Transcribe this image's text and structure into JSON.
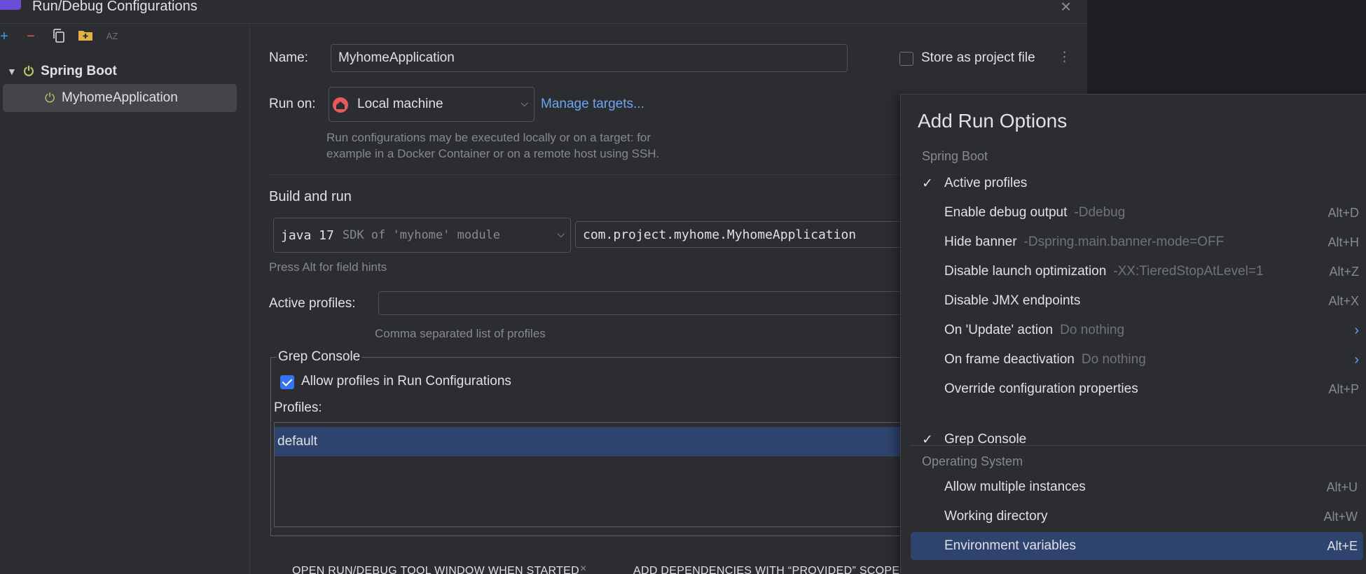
{
  "window": {
    "title": "Run/Debug Configurations",
    "close_glyph": "×"
  },
  "toolbar": {
    "add_glyph": "+",
    "remove_glyph": "−",
    "sort_glyph": "AZ"
  },
  "tree": {
    "group_label": "Spring Boot",
    "item_label": "MyhomeApplication"
  },
  "form": {
    "name_label": "Name:",
    "name_value": "MyhomeApplication",
    "store_label": "Store as project file",
    "run_on_label": "Run on:",
    "run_on_value": "Local machine",
    "manage_targets": "Manage targets...",
    "run_on_hint_1": "Run configurations may be executed locally or on a target: for",
    "run_on_hint_2": "example in a Docker Container or on a remote host using SSH.",
    "build_title": "Build and run",
    "jdk_value": "java 17",
    "jdk_hint": "SDK of 'myhome' module",
    "main_class": "com.project.myhome.MyhomeApplication",
    "field_hint": "Press Alt for field hints",
    "profiles_label": "Active profiles:",
    "profiles_hint": "Comma separated list of profiles",
    "grep_title": "Grep Console",
    "allow_profiles_label": "Allow profiles in Run Configurations",
    "profiles_list_label": "Profiles:",
    "profiles_list": [
      "default"
    ],
    "open_tool_window": "OPEN RUN/DEBUG TOOL WINDOW WHEN STARTED",
    "add_dependencies": "ADD DEPENDENCIES WITH “PROVIDED” SCOPE"
  },
  "popup": {
    "title": "Add Run Options",
    "section_spring": "Spring Boot",
    "section_os": "Operating System",
    "spring_options": [
      {
        "label": "Active profiles",
        "hint": "",
        "key": "",
        "checked": true,
        "arrow": false
      },
      {
        "label": "Enable debug output",
        "hint": "-Ddebug",
        "key": "Alt+D",
        "checked": false,
        "arrow": false
      },
      {
        "label": "Hide banner",
        "hint": "-Dspring.main.banner-mode=OFF",
        "key": "Alt+H",
        "checked": false,
        "arrow": false
      },
      {
        "label": "Disable launch optimization",
        "hint": "-XX:TieredStopAtLevel=1",
        "key": "Alt+Z",
        "checked": false,
        "arrow": false
      },
      {
        "label": "Disable JMX endpoints",
        "hint": "",
        "key": "Alt+X",
        "checked": false,
        "arrow": false
      },
      {
        "label": "On 'Update' action",
        "hint": "Do nothing",
        "key": "›",
        "checked": false,
        "arrow": true
      },
      {
        "label": "On frame deactivation",
        "hint": "Do nothing",
        "key": "›",
        "checked": false,
        "arrow": true
      },
      {
        "label": "Override configuration properties",
        "hint": "",
        "key": "Alt+P",
        "checked": false,
        "arrow": false
      }
    ],
    "grep_option": {
      "label": "Grep Console",
      "checked": true
    },
    "os_options": [
      {
        "label": "Allow multiple instances",
        "key": "Alt+U",
        "selected": false
      },
      {
        "label": "Working directory",
        "key": "Alt+W",
        "selected": false
      },
      {
        "label": "Environment variables",
        "key": "Alt+E",
        "selected": true
      }
    ],
    "check_glyph": "✓"
  }
}
